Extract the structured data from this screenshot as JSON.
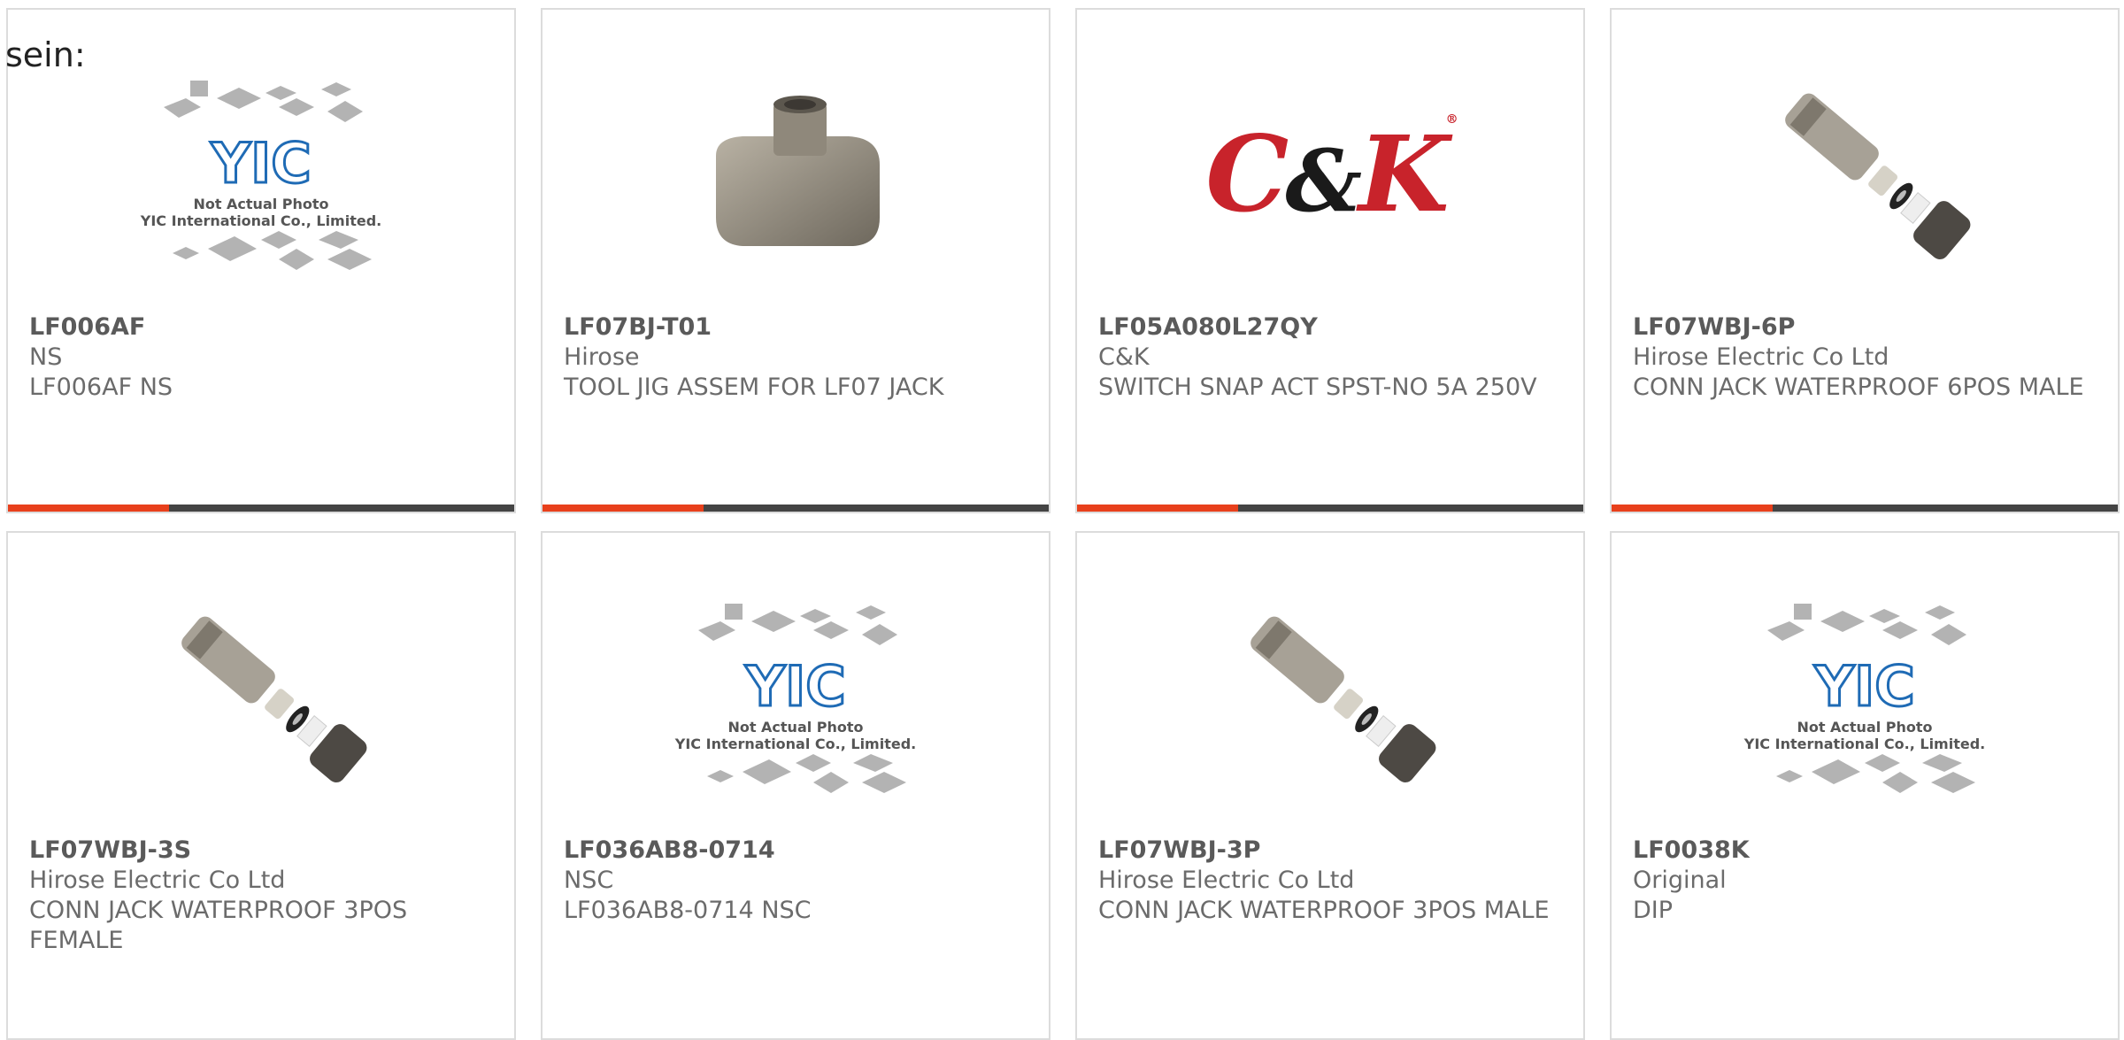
{
  "prefix_text": "sein:",
  "colors": {
    "accent": "#e8401c",
    "bar": "#444444",
    "border": "#dcdcdc",
    "yic_blue": "#1f6bb5"
  },
  "placeholder_image": {
    "logo_text": "YIC",
    "caption_line1": "Not Actual Photo",
    "caption_line2": "YIC International Co., Limited."
  },
  "brand_logo": {
    "c": "C",
    "amp": "&",
    "k": "K",
    "reg": "®"
  },
  "products": [
    {
      "part": "LF006AF",
      "maker": "NS",
      "desc": "LF006AF NS",
      "image": "yic-placeholder"
    },
    {
      "part": "LF07BJ-T01",
      "maker": "Hirose",
      "desc": "TOOL JIG ASSEM FOR LF07 JACK",
      "image": "metal-jig"
    },
    {
      "part": "LF05A080L27QY",
      "maker": "C&K",
      "desc": "SWITCH SNAP ACT SPST-NO 5A 250V",
      "image": "ck-logo"
    },
    {
      "part": "LF07WBJ-6P",
      "maker": "Hirose Electric Co Ltd",
      "desc": "CONN JACK WATERPROOF 6POS MALE",
      "image": "connector-exploded"
    },
    {
      "part": "LF07WBJ-3S",
      "maker": "Hirose Electric Co Ltd",
      "desc": "CONN JACK WATERPROOF 3POS FEMALE",
      "image": "connector-exploded"
    },
    {
      "part": "LF036AB8-0714",
      "maker": "NSC",
      "desc": "LF036AB8-0714 NSC",
      "image": "yic-placeholder"
    },
    {
      "part": "LF07WBJ-3P",
      "maker": "Hirose Electric Co Ltd",
      "desc": "CONN JACK WATERPROOF 3POS MALE",
      "image": "connector-exploded"
    },
    {
      "part": "LF0038K",
      "maker": "Original",
      "desc": "DIP",
      "image": "yic-placeholder"
    }
  ]
}
